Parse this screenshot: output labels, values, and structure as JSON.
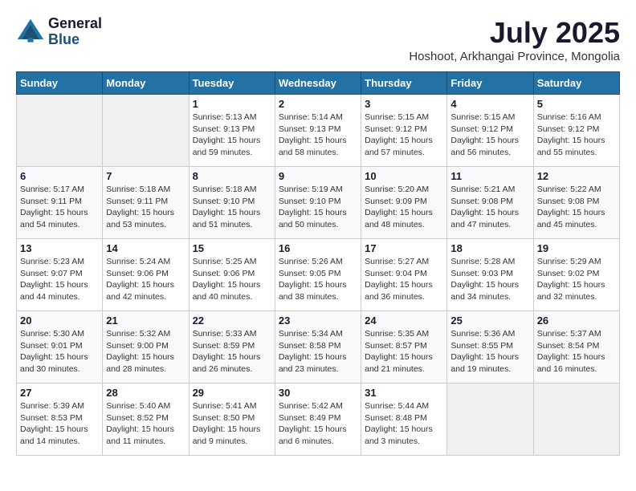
{
  "header": {
    "logo_line1": "General",
    "logo_line2": "Blue",
    "month_year": "July 2025",
    "location": "Hoshoot, Arkhangai Province, Mongolia"
  },
  "weekdays": [
    "Sunday",
    "Monday",
    "Tuesday",
    "Wednesday",
    "Thursday",
    "Friday",
    "Saturday"
  ],
  "weeks": [
    [
      {
        "day": "",
        "info": ""
      },
      {
        "day": "",
        "info": ""
      },
      {
        "day": "1",
        "info": "Sunrise: 5:13 AM\nSunset: 9:13 PM\nDaylight: 15 hours and 59 minutes."
      },
      {
        "day": "2",
        "info": "Sunrise: 5:14 AM\nSunset: 9:13 PM\nDaylight: 15 hours and 58 minutes."
      },
      {
        "day": "3",
        "info": "Sunrise: 5:15 AM\nSunset: 9:12 PM\nDaylight: 15 hours and 57 minutes."
      },
      {
        "day": "4",
        "info": "Sunrise: 5:15 AM\nSunset: 9:12 PM\nDaylight: 15 hours and 56 minutes."
      },
      {
        "day": "5",
        "info": "Sunrise: 5:16 AM\nSunset: 9:12 PM\nDaylight: 15 hours and 55 minutes."
      }
    ],
    [
      {
        "day": "6",
        "info": "Sunrise: 5:17 AM\nSunset: 9:11 PM\nDaylight: 15 hours and 54 minutes."
      },
      {
        "day": "7",
        "info": "Sunrise: 5:18 AM\nSunset: 9:11 PM\nDaylight: 15 hours and 53 minutes."
      },
      {
        "day": "8",
        "info": "Sunrise: 5:18 AM\nSunset: 9:10 PM\nDaylight: 15 hours and 51 minutes."
      },
      {
        "day": "9",
        "info": "Sunrise: 5:19 AM\nSunset: 9:10 PM\nDaylight: 15 hours and 50 minutes."
      },
      {
        "day": "10",
        "info": "Sunrise: 5:20 AM\nSunset: 9:09 PM\nDaylight: 15 hours and 48 minutes."
      },
      {
        "day": "11",
        "info": "Sunrise: 5:21 AM\nSunset: 9:08 PM\nDaylight: 15 hours and 47 minutes."
      },
      {
        "day": "12",
        "info": "Sunrise: 5:22 AM\nSunset: 9:08 PM\nDaylight: 15 hours and 45 minutes."
      }
    ],
    [
      {
        "day": "13",
        "info": "Sunrise: 5:23 AM\nSunset: 9:07 PM\nDaylight: 15 hours and 44 minutes."
      },
      {
        "day": "14",
        "info": "Sunrise: 5:24 AM\nSunset: 9:06 PM\nDaylight: 15 hours and 42 minutes."
      },
      {
        "day": "15",
        "info": "Sunrise: 5:25 AM\nSunset: 9:06 PM\nDaylight: 15 hours and 40 minutes."
      },
      {
        "day": "16",
        "info": "Sunrise: 5:26 AM\nSunset: 9:05 PM\nDaylight: 15 hours and 38 minutes."
      },
      {
        "day": "17",
        "info": "Sunrise: 5:27 AM\nSunset: 9:04 PM\nDaylight: 15 hours and 36 minutes."
      },
      {
        "day": "18",
        "info": "Sunrise: 5:28 AM\nSunset: 9:03 PM\nDaylight: 15 hours and 34 minutes."
      },
      {
        "day": "19",
        "info": "Sunrise: 5:29 AM\nSunset: 9:02 PM\nDaylight: 15 hours and 32 minutes."
      }
    ],
    [
      {
        "day": "20",
        "info": "Sunrise: 5:30 AM\nSunset: 9:01 PM\nDaylight: 15 hours and 30 minutes."
      },
      {
        "day": "21",
        "info": "Sunrise: 5:32 AM\nSunset: 9:00 PM\nDaylight: 15 hours and 28 minutes."
      },
      {
        "day": "22",
        "info": "Sunrise: 5:33 AM\nSunset: 8:59 PM\nDaylight: 15 hours and 26 minutes."
      },
      {
        "day": "23",
        "info": "Sunrise: 5:34 AM\nSunset: 8:58 PM\nDaylight: 15 hours and 23 minutes."
      },
      {
        "day": "24",
        "info": "Sunrise: 5:35 AM\nSunset: 8:57 PM\nDaylight: 15 hours and 21 minutes."
      },
      {
        "day": "25",
        "info": "Sunrise: 5:36 AM\nSunset: 8:55 PM\nDaylight: 15 hours and 19 minutes."
      },
      {
        "day": "26",
        "info": "Sunrise: 5:37 AM\nSunset: 8:54 PM\nDaylight: 15 hours and 16 minutes."
      }
    ],
    [
      {
        "day": "27",
        "info": "Sunrise: 5:39 AM\nSunset: 8:53 PM\nDaylight: 15 hours and 14 minutes."
      },
      {
        "day": "28",
        "info": "Sunrise: 5:40 AM\nSunset: 8:52 PM\nDaylight: 15 hours and 11 minutes."
      },
      {
        "day": "29",
        "info": "Sunrise: 5:41 AM\nSunset: 8:50 PM\nDaylight: 15 hours and 9 minutes."
      },
      {
        "day": "30",
        "info": "Sunrise: 5:42 AM\nSunset: 8:49 PM\nDaylight: 15 hours and 6 minutes."
      },
      {
        "day": "31",
        "info": "Sunrise: 5:44 AM\nSunset: 8:48 PM\nDaylight: 15 hours and 3 minutes."
      },
      {
        "day": "",
        "info": ""
      },
      {
        "day": "",
        "info": ""
      }
    ]
  ]
}
